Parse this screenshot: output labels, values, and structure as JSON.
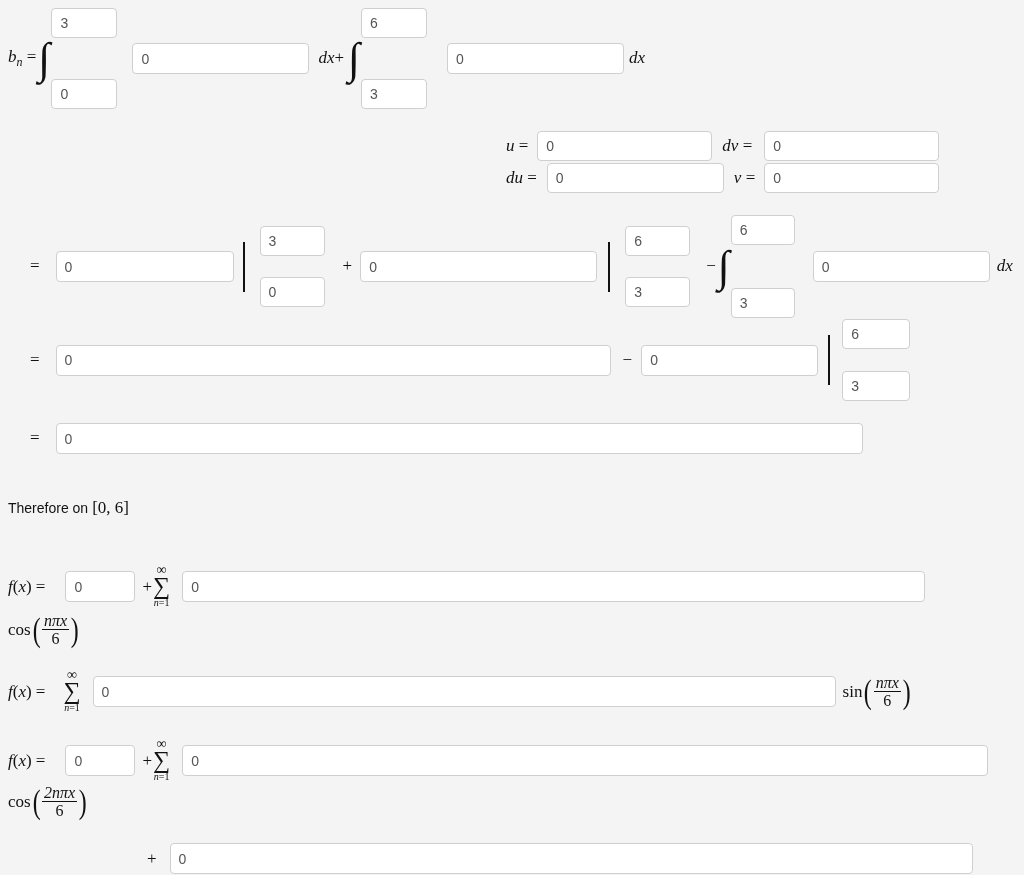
{
  "rows": [
    {
      "items": [
        {
          "kind": "math",
          "text": "*b*$_{n}$ ="
        },
        {
          "kind": "integral",
          "sign": "∫",
          "upper": "3",
          "lower": "0"
        },
        {
          "kind": "field",
          "value": "0"
        },
        {
          "kind": "math",
          "text": "*dx*+"
        },
        {
          "kind": "integral",
          "sign": "∫",
          "upper": "6",
          "lower": "3"
        },
        {
          "kind": "field",
          "value": "0"
        },
        {
          "kind": "math",
          "text": "*dx*"
        }
      ]
    },
    {
      "items": [
        {
          "kind": "math",
          "text": "*u* ="
        },
        {
          "kind": "field",
          "value": "0"
        },
        {
          "kind": "math",
          "text": "*dv* ="
        },
        {
          "kind": "field",
          "value": "0"
        }
      ]
    },
    {
      "items": [
        {
          "kind": "math",
          "text": "*du* ="
        },
        {
          "kind": "field",
          "value": "0"
        },
        {
          "kind": "math",
          "text": "*v* ="
        },
        {
          "kind": "field",
          "value": "0"
        }
      ]
    },
    {
      "items": [
        {
          "kind": "math",
          "text": "="
        },
        {
          "kind": "field",
          "value": "0"
        },
        {
          "kind": "evaluation",
          "upper": "3",
          "lower": "0"
        },
        {
          "kind": "math",
          "text": "+"
        },
        {
          "kind": "field",
          "value": "0"
        },
        {
          "kind": "evaluation",
          "upper": "6",
          "lower": "3"
        },
        {
          "kind": "math",
          "text": "−"
        },
        {
          "kind": "integral",
          "sign": "∫",
          "upper": "6",
          "lower": "3"
        },
        {
          "kind": "field",
          "value": "0"
        },
        {
          "kind": "math",
          "text": "*dx*"
        }
      ]
    },
    {
      "items": [
        {
          "kind": "math",
          "text": "="
        },
        {
          "kind": "field",
          "value": "0"
        },
        {
          "kind": "math",
          "text": "−"
        },
        {
          "kind": "field",
          "value": "0"
        },
        {
          "kind": "evaluation",
          "upper": "6",
          "lower": "3"
        }
      ]
    },
    {
      "items": [
        {
          "kind": "math",
          "text": "="
        },
        {
          "kind": "field",
          "value": "0"
        }
      ]
    },
    {
      "items": [
        {
          "kind": "text",
          "text": "Therefore on"
        },
        {
          "kind": "math",
          "text": "[0, 6]"
        }
      ]
    },
    {
      "items": [
        {
          "kind": "math",
          "text": "*f*(*x*) ="
        },
        {
          "kind": "field",
          "value": "0"
        },
        {
          "kind": "math",
          "text": "+"
        },
        {
          "kind": "sum",
          "top": "∞",
          "sign": "∑",
          "bottom": "*n*=1"
        },
        {
          "kind": "field",
          "value": "0"
        }
      ]
    },
    {
      "items": [
        {
          "kind": "function",
          "name": "cos",
          "open": "(",
          "numerator": "nπx",
          "denominator": "6",
          "close": ")"
        }
      ]
    },
    {
      "items": [
        {
          "kind": "math",
          "text": "*f*(*x*) ="
        },
        {
          "kind": "sum",
          "top": "∞",
          "sign": "∑",
          "bottom": "*n*=1"
        },
        {
          "kind": "field",
          "value": "0"
        },
        {
          "kind": "function",
          "name": "sin",
          "open": "(",
          "numerator": "nπx",
          "denominator": "6",
          "close": ")"
        }
      ]
    },
    {
      "items": [
        {
          "kind": "math",
          "text": "*f*(*x*) ="
        },
        {
          "kind": "field",
          "value": "0"
        },
        {
          "kind": "math",
          "text": "+"
        },
        {
          "kind": "sum",
          "top": "∞",
          "sign": "∑",
          "bottom": "*n*=1"
        },
        {
          "kind": "field",
          "value": "0"
        }
      ]
    },
    {
      "items": [
        {
          "kind": "function",
          "name": "cos",
          "open": "(",
          "numerator": "2nπx",
          "denominator": "6",
          "close": ")"
        }
      ]
    },
    {
      "items": [
        {
          "kind": "math",
          "text": "+"
        },
        {
          "kind": "field",
          "value": "0"
        }
      ]
    }
  ]
}
